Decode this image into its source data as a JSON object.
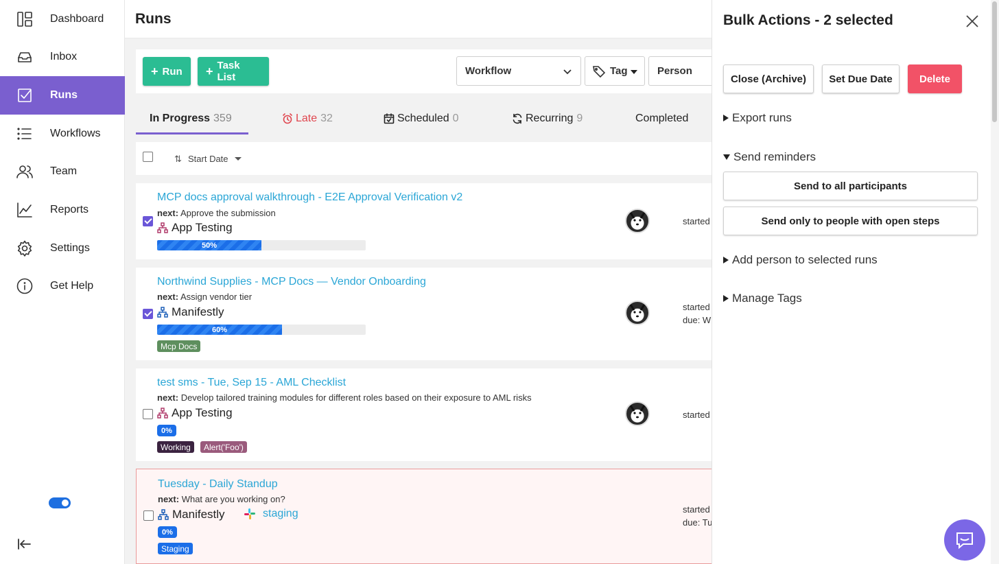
{
  "sidebar": {
    "items": [
      {
        "label": "Dashboard",
        "icon": "dashboard-icon"
      },
      {
        "label": "Inbox",
        "icon": "inbox-icon"
      },
      {
        "label": "Runs",
        "icon": "runs-icon",
        "active": true
      },
      {
        "label": "Workflows",
        "icon": "list-icon"
      },
      {
        "label": "Team",
        "icon": "team-icon"
      },
      {
        "label": "Reports",
        "icon": "chart-icon"
      },
      {
        "label": "Settings",
        "icon": "gear-icon"
      },
      {
        "label": "Get Help",
        "icon": "info-icon"
      }
    ],
    "toggle_on": true
  },
  "header": {
    "title": "Runs"
  },
  "toolbar": {
    "run_label": "Run",
    "tasklist_label": "Task List",
    "workflow_select": "Workflow",
    "tag_select": "Tag",
    "person_select": "Person"
  },
  "tabs": [
    {
      "label": "In Progress",
      "count": "359",
      "active": true
    },
    {
      "label": "Late",
      "count": "32"
    },
    {
      "label": "Scheduled",
      "count": "0"
    },
    {
      "label": "Recurring",
      "count": "9"
    },
    {
      "label": "Completed",
      "count": ""
    }
  ],
  "sort": {
    "label": "Start Date"
  },
  "runs": [
    {
      "title": "MCP docs approval walkthrough - E2E Approval Verification v2",
      "next_label": "next:",
      "next": "Approve the submission",
      "workflow": "App Testing",
      "progress_pct": "50%",
      "progress": 0.5,
      "checked": true,
      "started": "started"
    },
    {
      "title": "Northwind Supplies - MCP Docs — Vendor Onboarding",
      "next_label": "next:",
      "next": "Assign vendor tier",
      "workflow": "Manifestly",
      "progress_pct": "60%",
      "progress": 0.6,
      "checked": true,
      "tags": [
        "Mcp Docs"
      ],
      "started": "started",
      "due": "due: W"
    },
    {
      "title": "test sms - Tue, Sep 15 - AML Checklist",
      "next_label": "next:",
      "next": "Develop tailored training modules for different roles based on their exposure to AML risks",
      "workflow": "App Testing",
      "progress_pct": "0%",
      "progress": 0,
      "checked": false,
      "tags": [
        "Working",
        "Alert('Foo')"
      ],
      "started": "started"
    },
    {
      "title": "Tuesday - Daily Standup",
      "next_label": "next:",
      "next": "What are you working on?",
      "workflow": "Manifestly",
      "slack_channel": "staging",
      "progress_pct": "0%",
      "progress": 0,
      "checked": false,
      "tags": [
        "Staging"
      ],
      "started": "started",
      "due": "due: Tu",
      "late": true
    }
  ],
  "colors": {
    "accent": "#7a5fcf",
    "green": "#2bbd93",
    "link": "#2aa6d6",
    "danger": "#f25267",
    "late": "#e0464f"
  },
  "panel": {
    "title": "Bulk Actions - 2 selected",
    "close_archive": "Close (Archive)",
    "set_due_date": "Set Due Date",
    "delete": "Delete",
    "export_runs": "Export runs",
    "send_reminders": "Send reminders",
    "send_all": "Send to all participants",
    "send_open": "Send only to people with open steps",
    "add_person": "Add person to selected runs",
    "manage_tags": "Manage Tags"
  }
}
